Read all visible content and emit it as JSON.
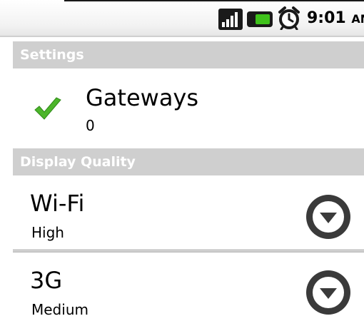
{
  "status_bar": {
    "time": "9:01",
    "ampm": "AM",
    "icons": [
      "signal-icon",
      "battery-icon",
      "alarm-clock-icon"
    ],
    "colors": {
      "battery": "#3fc21b"
    }
  },
  "settings": {
    "header": "Settings",
    "gateways": {
      "title": "Gateways",
      "count": "0",
      "icon": "check-icon",
      "icon_color": "#4cb52a"
    }
  },
  "display_quality": {
    "header": "Display Quality",
    "rows": [
      {
        "title": "Wi-Fi",
        "value": "High",
        "icon": "dropdown-arrow-icon"
      },
      {
        "title": "3G",
        "value": "Medium",
        "icon": "dropdown-arrow-icon"
      }
    ]
  },
  "colors": {
    "section_header_bg": "#cfcfcf",
    "section_header_text": "#ffffff",
    "dropdown_bg": "#3a3a3a"
  }
}
